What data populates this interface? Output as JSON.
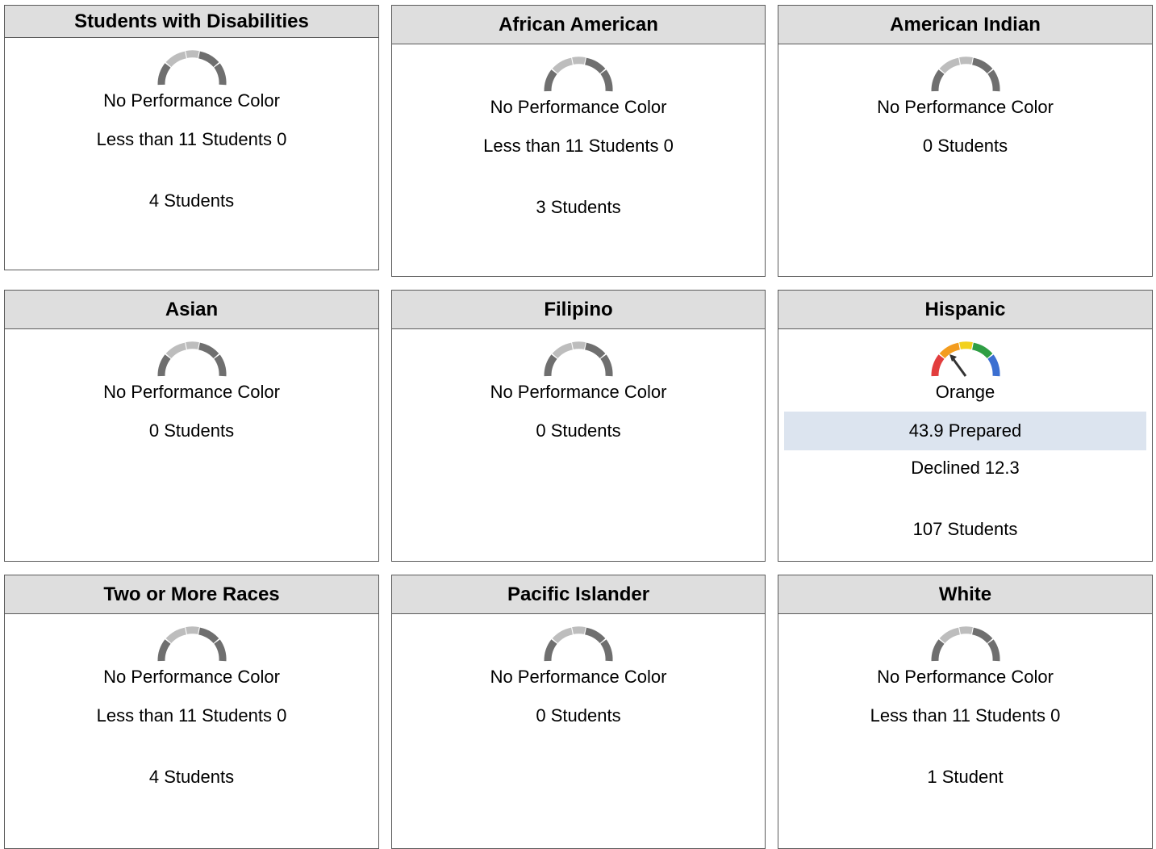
{
  "cards": [
    {
      "title": "Students with Disabilities",
      "color_label": "No Performance Color",
      "line1": "Less than 11 Students 0",
      "count": "4 Students"
    },
    {
      "title": "African American",
      "color_label": "No Performance Color",
      "line1": "Less than 11 Students 0",
      "count": "3 Students"
    },
    {
      "title": "American Indian",
      "color_label": "No Performance Color",
      "count": "0 Students"
    },
    {
      "title": "Asian",
      "color_label": "No Performance Color",
      "count": "0 Students"
    },
    {
      "title": "Filipino",
      "color_label": "No Performance Color",
      "count": "0 Students"
    },
    {
      "title": "Hispanic",
      "color_label": "Orange",
      "status": "43.9 Prepared",
      "change": "Declined 12.3",
      "count": "107 Students",
      "gauge_level": "orange"
    },
    {
      "title": "Two or More Races",
      "color_label": "No Performance Color",
      "line1": "Less than 11 Students 0",
      "count": "4 Students"
    },
    {
      "title": "Pacific Islander",
      "color_label": "No Performance Color",
      "count": "0 Students"
    },
    {
      "title": "White",
      "color_label": "No Performance Color",
      "line1": "Less than 11 Students 0",
      "count": "1 Student"
    }
  ],
  "colors": {
    "header_bg": "#dedede",
    "border": "#5a5a5a",
    "status_bg": "#dce4ef",
    "gauge_grey_dark": "#6f6f6f",
    "gauge_grey_light": "#bdbdbd",
    "gauge_red": "#e23d3d",
    "gauge_orange": "#f39c1e",
    "gauge_yellow": "#f2d11b",
    "gauge_green": "#2f9e44",
    "gauge_blue": "#3b6fd1"
  }
}
